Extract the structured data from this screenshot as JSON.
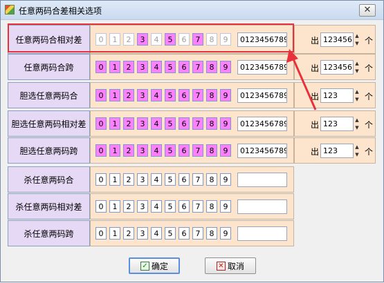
{
  "window": {
    "title": "任意两码合差相关选项",
    "close_glyph": "✕"
  },
  "digits": [
    "0",
    "1",
    "2",
    "3",
    "4",
    "5",
    "6",
    "7",
    "8",
    "9"
  ],
  "count_prefix": "出",
  "count_suffix": "个",
  "scroll_up": "▲",
  "scroll_down": "▼",
  "rows": [
    {
      "label": "任意两码合相对差",
      "states": [
        "dim",
        "dim",
        "dim",
        "on",
        "dim",
        "on",
        "dim",
        "on",
        "dim",
        "dim"
      ],
      "value": "0123456789",
      "count": "123456",
      "has_count": true,
      "highlighted": true
    },
    {
      "label": "任意两码合跨",
      "states": [
        "on",
        "on",
        "on",
        "on",
        "on",
        "on",
        "on",
        "on",
        "on",
        "on"
      ],
      "value": "0123456789",
      "count": "123456",
      "has_count": true
    },
    {
      "label": "胆选任意两码合",
      "states": [
        "on",
        "on",
        "on",
        "on",
        "on",
        "on",
        "on",
        "on",
        "on",
        "on"
      ],
      "value": "0123456789",
      "count": "123",
      "has_count": true
    },
    {
      "label": "胆选任意两码相对差",
      "states": [
        "on",
        "on",
        "on",
        "on",
        "on",
        "on",
        "on",
        "on",
        "on",
        "on"
      ],
      "value": "0123456789",
      "count": "123",
      "has_count": true
    },
    {
      "label": "胆选任意两码跨",
      "states": [
        "on",
        "on",
        "on",
        "on",
        "on",
        "on",
        "on",
        "on",
        "on",
        "on"
      ],
      "value": "0123456789",
      "count": "123",
      "has_count": true
    },
    {
      "label": "杀任意两码合",
      "states": [
        "off-white",
        "off-white",
        "off-white",
        "off-white",
        "off-white",
        "off-white",
        "off-white",
        "off-white",
        "off-white",
        "off-white"
      ],
      "value": "",
      "has_count": false
    },
    {
      "label": "杀任意两码相对差",
      "states": [
        "off-white",
        "off-white",
        "off-white",
        "off-white",
        "off-white",
        "off-white",
        "off-white",
        "off-white",
        "off-white",
        "off-white"
      ],
      "value": "",
      "has_count": false
    },
    {
      "label": "杀任意两码跨",
      "states": [
        "off-white",
        "off-white",
        "off-white",
        "off-white",
        "off-white",
        "off-white",
        "off-white",
        "off-white",
        "off-white",
        "off-white"
      ],
      "value": "",
      "has_count": false
    }
  ],
  "buttons": {
    "ok": "确定",
    "cancel": "取消"
  },
  "colors": {
    "selected": "#ff80ff",
    "label_bg": "#e6d9f5",
    "group_bg": "#fde5cd",
    "highlight": "#e8313b"
  }
}
